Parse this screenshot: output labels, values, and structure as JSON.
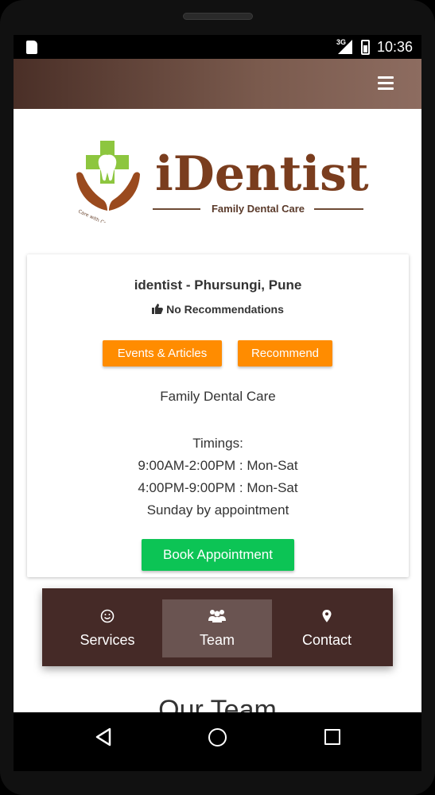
{
  "status_bar": {
    "network": "3G",
    "time": "10:36"
  },
  "header": {
    "menu_icon": "hamburger-menu-icon"
  },
  "logo": {
    "title": "iDentist",
    "tagline": "Family Dental Care",
    "emblem_text": "Care with Compassion",
    "colors": {
      "cross": "#8dc63f",
      "hands": "#9a4a1e",
      "text": "#7a3d1e"
    }
  },
  "clinic": {
    "name": "identist - Phursungi, Pune",
    "recommendations": "No Recommendations",
    "buttons": {
      "events": "Events & Articles",
      "recommend": "Recommend"
    },
    "description": "Family Dental Care",
    "timings_heading": "Timings:",
    "timings": [
      "9:00AM-2:00PM : Mon-Sat",
      "4:00PM-9:00PM : Mon-Sat",
      "Sunday by appointment"
    ],
    "book_button": "Book Appointment"
  },
  "tabs": [
    {
      "label": "Services",
      "icon": "smiley-icon",
      "active": false
    },
    {
      "label": "Team",
      "icon": "users-icon",
      "active": true
    },
    {
      "label": "Contact",
      "icon": "map-pin-icon",
      "active": false
    }
  ],
  "section": {
    "title": "Our Team"
  },
  "colors": {
    "header_gradient_start": "#4a2f27",
    "header_gradient_end": "#8d6c60",
    "accent_orange": "#ff8c00",
    "book_green": "#0cc455",
    "tab_bar": "#452a27"
  }
}
